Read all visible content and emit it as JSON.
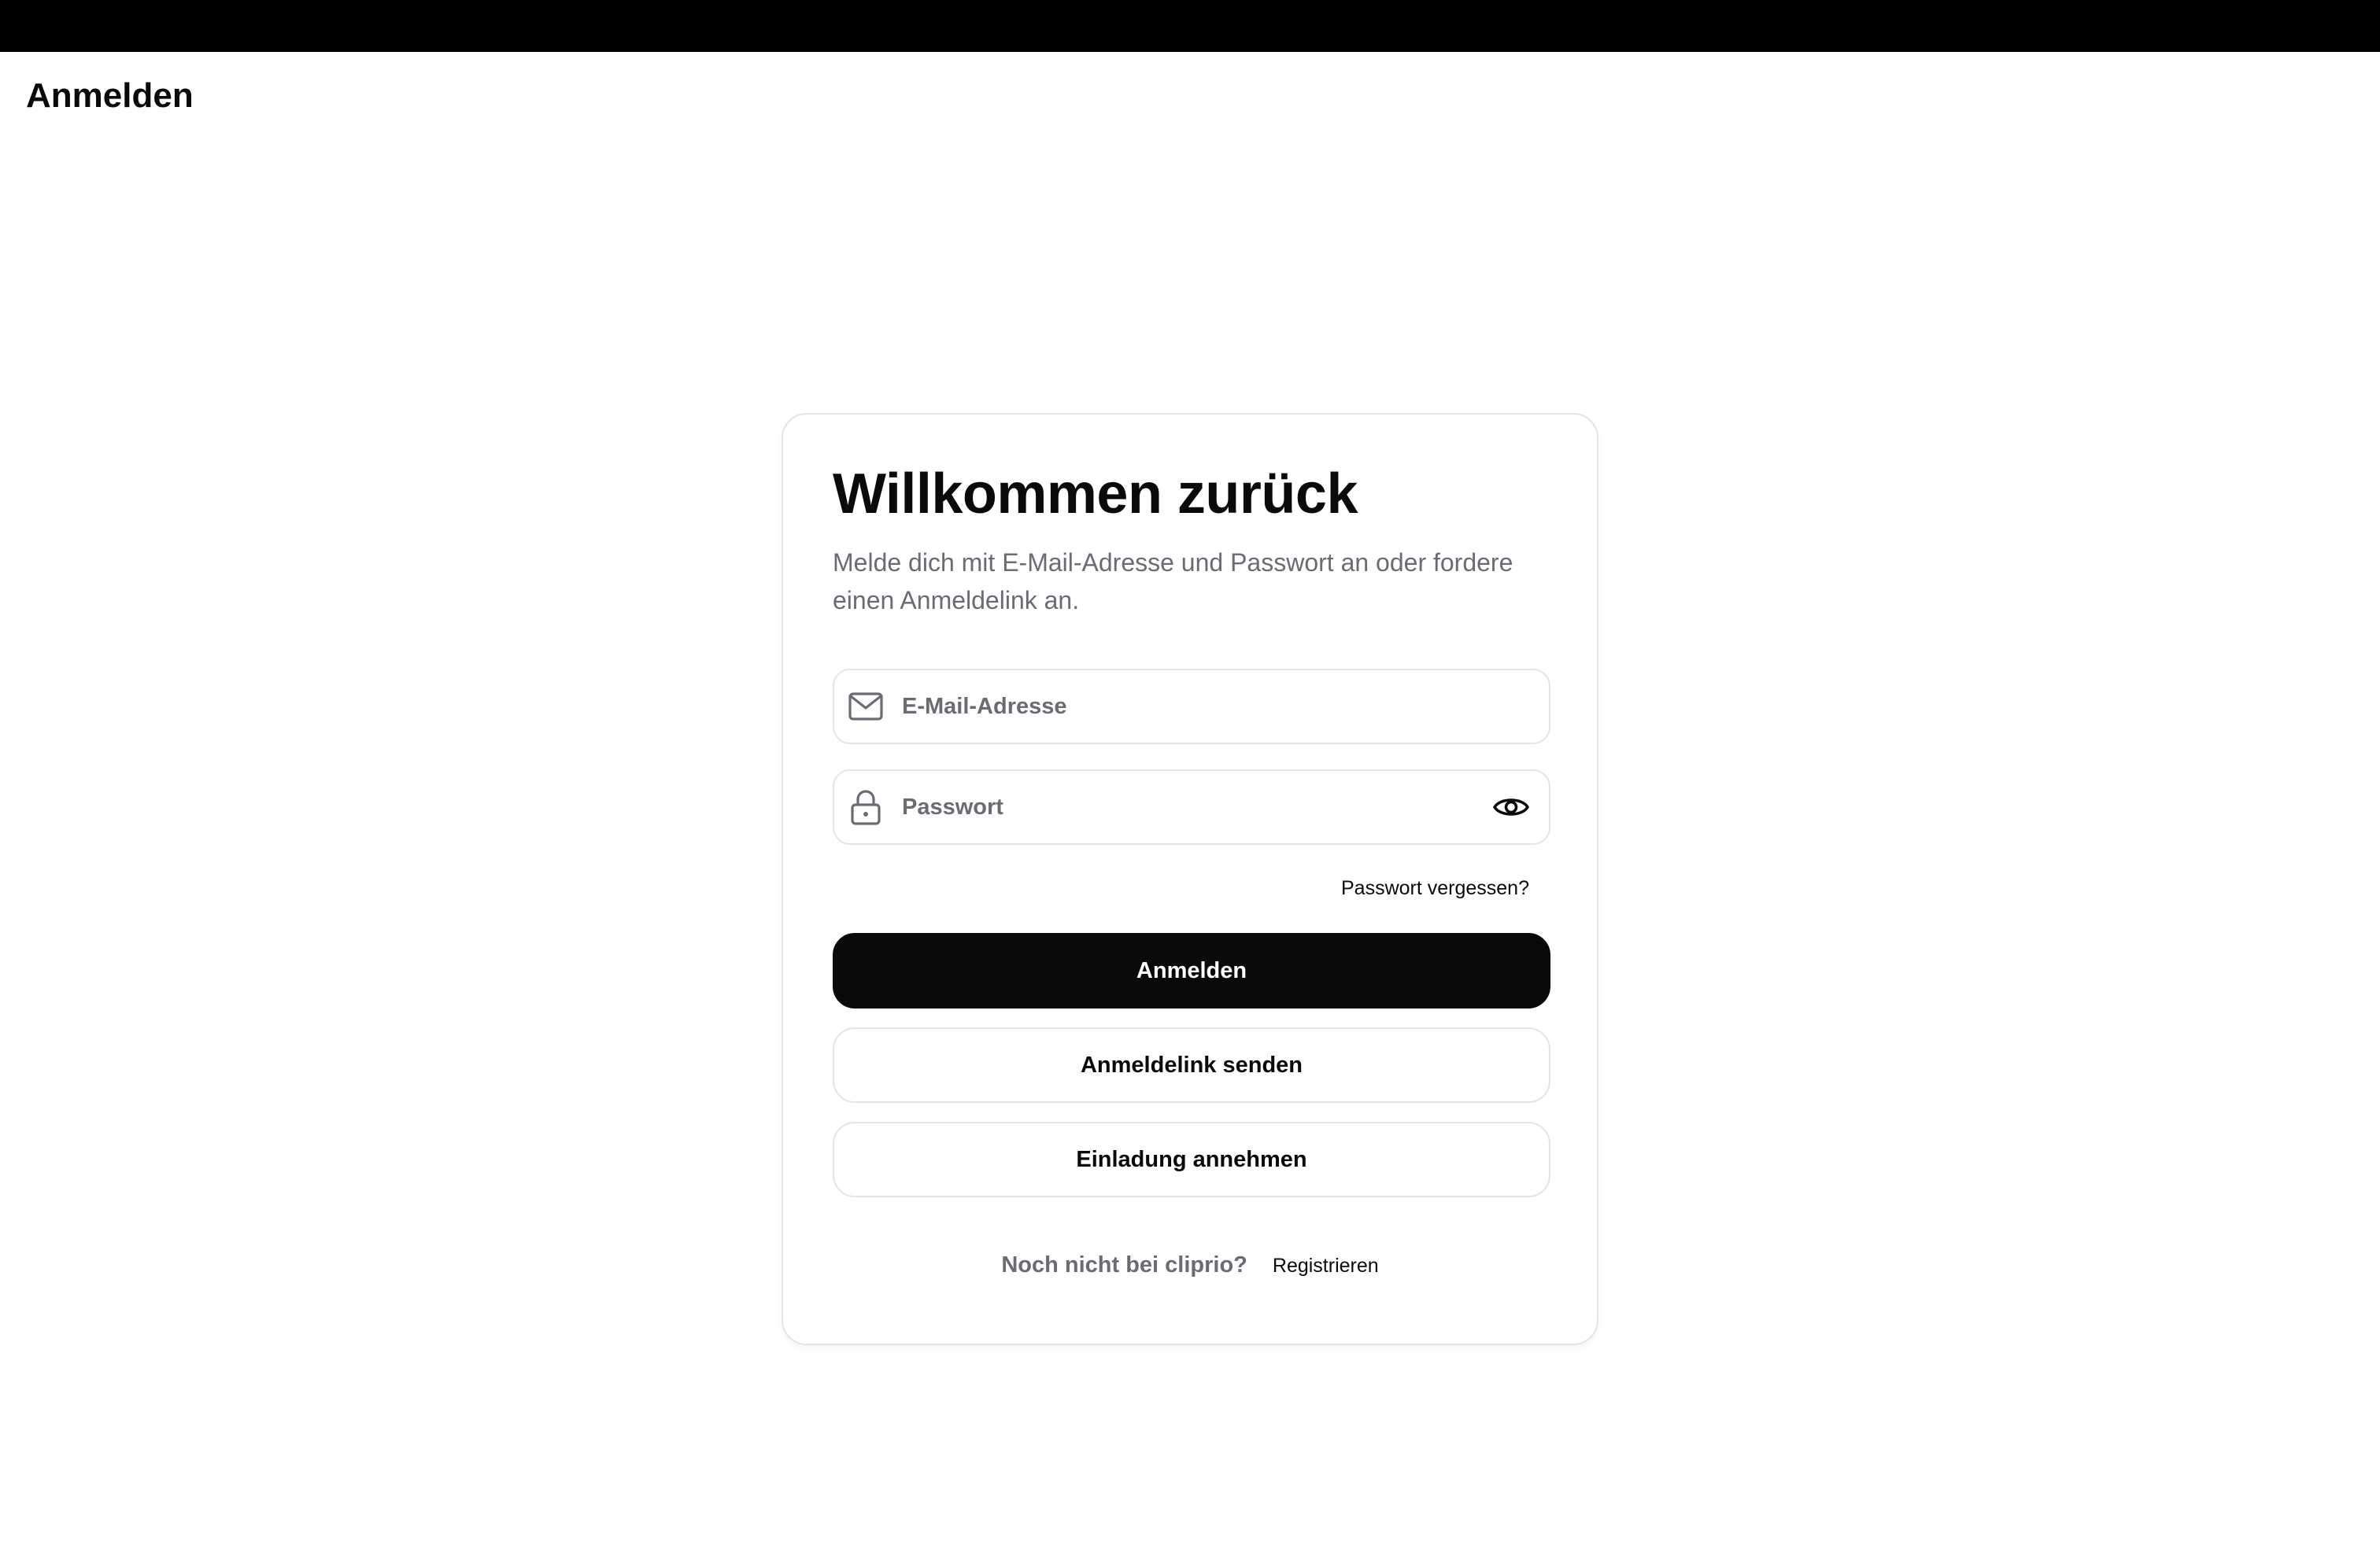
{
  "header": {
    "title": "Anmelden"
  },
  "login_card": {
    "title": "Willkommen zurück",
    "subtitle": "Melde dich mit E-Mail-Adresse und Passwort an oder fordere einen Anmeldelink an.",
    "email_field": {
      "placeholder": "E-Mail-Adresse",
      "value": "",
      "icon": "mail-icon"
    },
    "password_field": {
      "placeholder": "Passwort",
      "value": "",
      "icon": "lock-icon",
      "toggle_icon": "eye-icon"
    },
    "forgot_password_label": "Passwort vergessen?",
    "submit_label": "Anmelden",
    "magic_link_label": "Anmeldelink senden",
    "accept_invite_label": "Einladung annehmen",
    "footer": {
      "question": "Noch nicht bei cliprio?",
      "register_label": "Registrieren"
    }
  },
  "colors": {
    "topbar": "#000000",
    "primary_button": "#0a0a0b",
    "muted_text": "#6b6b73",
    "border": "#e4e4e7"
  }
}
